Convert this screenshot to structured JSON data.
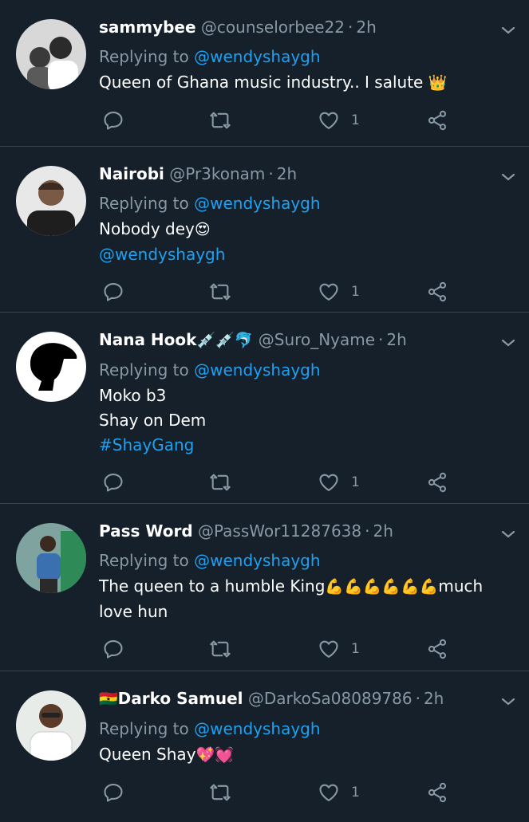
{
  "tweets": [
    {
      "name": "sammybee",
      "handle": "@counselorbee22",
      "time": "2h",
      "replying_prefix": "Replying to",
      "replying_to": "@wendyshaygh",
      "lines": [
        "Queen of Ghana music industry.. I salute"
      ],
      "trailing_emoji": "👑",
      "likes": "1"
    },
    {
      "name": "Nairobi",
      "handle": "@Pr3konam",
      "time": "2h",
      "replying_prefix": "Replying to",
      "replying_to": "@wendyshaygh",
      "lines": [
        "Nobody dey"
      ],
      "trailing_emoji": "😍",
      "link": "@wendyshaygh",
      "likes": "1"
    },
    {
      "name": "Nana Hook",
      "name_emoji": "💉💉🐬",
      "handle": "@Suro_Nyame",
      "time": "2h",
      "replying_prefix": "Replying to",
      "replying_to": "@wendyshaygh",
      "lines": [
        "Moko b3",
        "Shay on Dem"
      ],
      "link": "#ShayGang",
      "likes": "1"
    },
    {
      "name": "Pass Word",
      "handle": "@PassWor11287638",
      "time": "2h",
      "replying_prefix": "Replying to",
      "replying_to": "@wendyshaygh",
      "line_a": "The queen to a humble King",
      "inline_emoji": "💪💪💪💪💪💪",
      "line_b": "much love hun",
      "likes": "1"
    },
    {
      "name": "Darko Samuel",
      "name_prefix_emoji": "🇬🇭",
      "handle": "@DarkoSa08089786",
      "time": "2h",
      "replying_prefix": "Replying to",
      "replying_to": "@wendyshaygh",
      "lines": [
        "Queen Shay"
      ],
      "trailing_emoji": "💖💓",
      "likes": "1"
    }
  ],
  "colors": {
    "background": "#15202b",
    "divider": "#38444d",
    "secondary_text": "#8899a6",
    "link": "#1da1f2"
  },
  "icons": {
    "reply": "reply-icon",
    "retweet": "retweet-icon",
    "like": "heart-icon",
    "share": "share-icon",
    "menu": "chevron-down-icon"
  }
}
